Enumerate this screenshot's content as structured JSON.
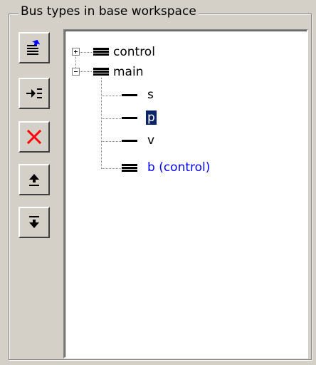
{
  "panel": {
    "title": "Bus types in base workspace"
  },
  "toolbar": [
    {
      "name": "add-bus-button",
      "icon": "add-bus-icon"
    },
    {
      "name": "insert-element-button",
      "icon": "insert-element-icon"
    },
    {
      "name": "delete-button",
      "icon": "delete-x-icon",
      "color": "#ff0000"
    },
    {
      "name": "move-up-button",
      "icon": "move-up-icon"
    },
    {
      "name": "move-down-button",
      "icon": "move-down-icon"
    }
  ],
  "tree": {
    "control": {
      "label": "control",
      "expanded": false
    },
    "main": {
      "label": "main",
      "expanded": true
    },
    "children": {
      "s": "s",
      "p": "p",
      "v": "v",
      "b": "b  (control)"
    },
    "selected": "p",
    "link_color": "#0000ff",
    "selection_color": "#0a246a"
  }
}
